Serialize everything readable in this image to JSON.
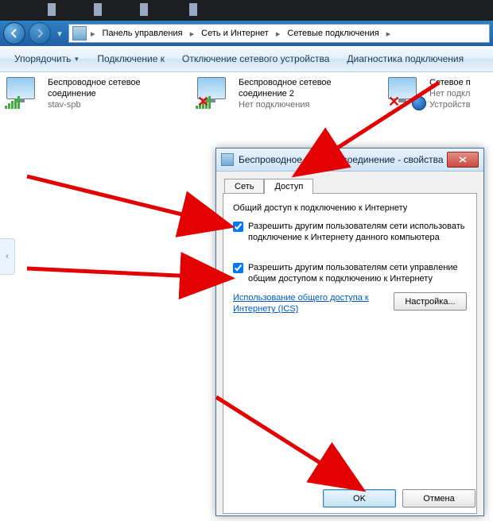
{
  "breadcrumb": {
    "seg1": "Панель управления",
    "seg2": "Сеть и Интернет",
    "seg3": "Сетевые подключения"
  },
  "toolbar": {
    "organize": "Упорядочить",
    "connect": "Подключение к",
    "disable": "Отключение сетевого устройства",
    "diagnose": "Диагностика подключения"
  },
  "connections": [
    {
      "name": "Беспроводное сетевое соединение",
      "sub": "stav-spb",
      "state": "ok"
    },
    {
      "name": "Беспроводное сетевое соединение 2",
      "sub": "Нет подключения",
      "state": "x"
    },
    {
      "name": "Сетевое п",
      "sub": "Нет подкл",
      "sub2": "Устройств",
      "state": "bt"
    }
  ],
  "dialog": {
    "title": "Беспроводное сетевое соединение - свойства",
    "tabs": {
      "net": "Сеть",
      "share": "Доступ"
    },
    "group_title": "Общий доступ к подключению к Интернету",
    "chk1": "Разрешить другим пользователям сети использовать подключение к Интернету данного компьютера",
    "chk2": "Разрешить другим пользователям сети управление общим доступом к подключению к Интернету",
    "link": "Использование общего доступа к Интернету (ICS)",
    "settings_btn": "Настройка...",
    "ok": "OK",
    "cancel": "Отмена"
  }
}
